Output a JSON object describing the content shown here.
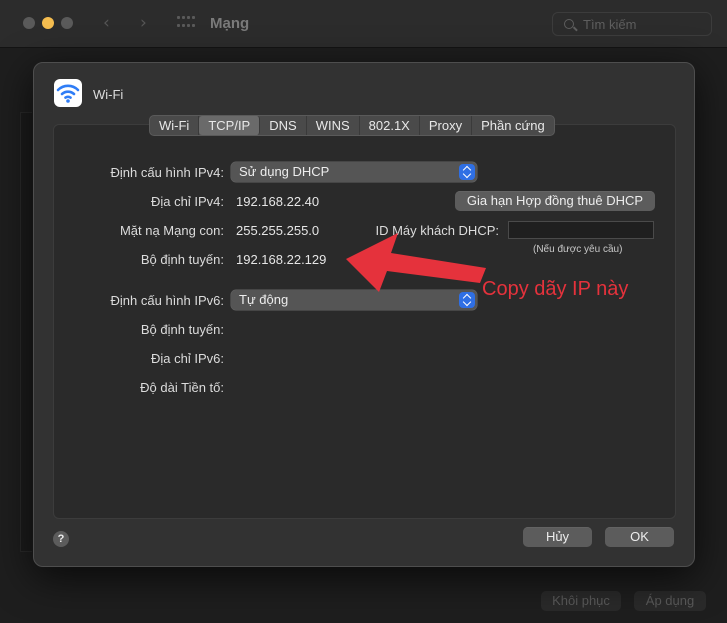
{
  "window": {
    "title": "Mạng",
    "search_placeholder": "Tìm kiếm",
    "restore_label": "Khôi phục",
    "apply_label": "Áp dụng"
  },
  "sheet": {
    "title": "Wi-Fi",
    "tabs": [
      {
        "label": "Wi-Fi",
        "active": false
      },
      {
        "label": "TCP/IP",
        "active": true
      },
      {
        "label": "DNS",
        "active": false
      },
      {
        "label": "WINS",
        "active": false
      },
      {
        "label": "802.1X",
        "active": false
      },
      {
        "label": "Proxy",
        "active": false
      },
      {
        "label": "Phần cứng",
        "active": false
      }
    ],
    "ipv4": {
      "config_label": "Định cấu hình IPv4:",
      "config_value": "Sử dụng DHCP",
      "address_label": "Địa chỉ IPv4:",
      "address_value": "192.168.22.40",
      "renew_button": "Gia hạn Hợp đồng thuê DHCP",
      "subnet_label": "Mặt nạ Mạng con:",
      "subnet_value": "255.255.255.0",
      "dhcp_client_label": "ID Máy khách DHCP:",
      "dhcp_client_value": "",
      "dhcp_client_hint": "(Nếu được yêu cầu)",
      "router_label": "Bộ định tuyến:",
      "router_value": "192.168.22.129"
    },
    "ipv6": {
      "config_label": "Định cấu hình IPv6:",
      "config_value": "Tự động",
      "router_label": "Bộ định tuyến:",
      "address_label": "Địa chỉ IPv6:",
      "prefix_label": "Độ dài Tiền tố:"
    },
    "help_label": "?",
    "cancel_label": "Hủy",
    "ok_label": "OK"
  },
  "annotation": {
    "text": "Copy dãy IP này",
    "color": "#e5323c"
  },
  "colors": {
    "accent": "#2f6fe4",
    "traffic_yellow": "#f5bd4f"
  }
}
